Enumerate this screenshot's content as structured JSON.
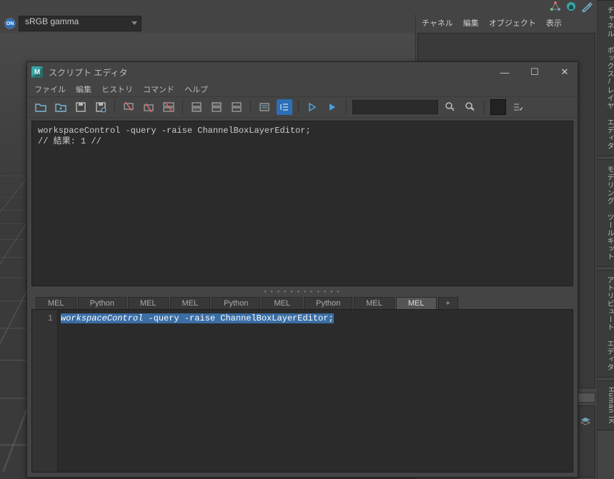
{
  "main_toolbar": {
    "icons": [
      "navigator-icon",
      "home-icon",
      "edit-pivot-icon"
    ]
  },
  "colormgmt": {
    "toggle_label": "ON",
    "selected": "sRGB gamma"
  },
  "right_panel": {
    "menus": [
      "チャネル",
      "編集",
      "オブジェクト",
      "表示"
    ]
  },
  "vtabs": [
    "チャネル ボックス/レイヤ エディタ",
    "モデリング ツールキット",
    "アトリビュート エディタ",
    "Human IK"
  ],
  "script_editor": {
    "title": "スクリプト エディタ",
    "logo_text": "M",
    "menus": [
      "ファイル",
      "編集",
      "ヒストリ",
      "コマンド",
      "ヘルプ"
    ],
    "output": "workspaceControl -query -raise ChannelBoxLayerEditor;\n// 結果: 1 //",
    "tabs": [
      {
        "label": "MEL",
        "active": false
      },
      {
        "label": "Python",
        "active": false
      },
      {
        "label": "MEL",
        "active": false
      },
      {
        "label": "MEL",
        "active": false
      },
      {
        "label": "Python",
        "active": false
      },
      {
        "label": "MEL",
        "active": false
      },
      {
        "label": "Python",
        "active": false
      },
      {
        "label": "MEL",
        "active": false
      },
      {
        "label": "MEL",
        "active": true
      },
      {
        "label": "+",
        "active": false
      }
    ],
    "gutter": "1",
    "code_keyword": "workspaceControl",
    "code_rest": " -query -raise ChannelBoxLayerEditor;"
  }
}
